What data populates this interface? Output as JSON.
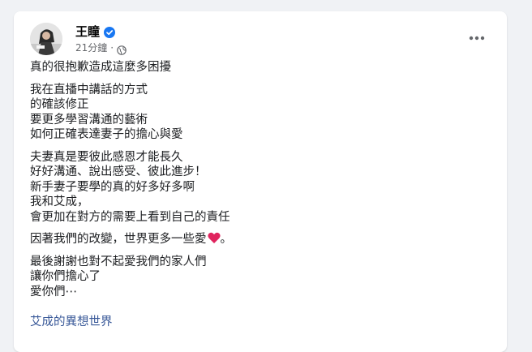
{
  "post": {
    "author": {
      "name": "王瞳",
      "verified_icon": "verified-badge-icon",
      "avatar_icon": "profile-photo"
    },
    "timestamp": "21分鐘",
    "meta_separator": "·",
    "privacy_icon": "globe-icon",
    "more_icon": "more-options-icon",
    "paragraphs": [
      [
        "真的很抱歉造成這麼多困擾"
      ],
      [
        "我在直播中講話的方式",
        "的確該修正",
        "要更多學習溝通的藝術",
        "如何正確表達妻子的擔心與愛"
      ],
      [
        "夫妻真是要彼此感恩才能長久",
        "好好溝通、說出感受、彼此進步！",
        "新手妻子要學的真的好多好多啊",
        "我和艾成，",
        "會更加在對方的需要上看到自己的責任"
      ],
      [
        "因著我們的改變，世界更多一些愛",
        "。"
      ],
      [
        "最後謝謝也對不起愛我們的家人們",
        "讓你們擔心了",
        "愛你們⋯"
      ]
    ],
    "heart_emoji_icon": "red-heart-icon",
    "link_text": "艾成的異想世界"
  },
  "colors": {
    "background": "#f0f2f5",
    "card": "#ffffff",
    "text": "#1c1e21",
    "secondary_text": "#65676b",
    "link": "#385898",
    "verified": "#1877f2",
    "heart": "#e0245e"
  }
}
